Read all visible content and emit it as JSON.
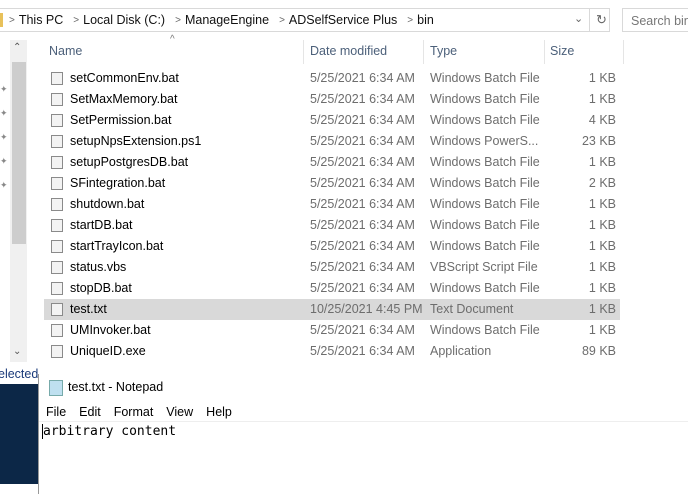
{
  "explorer": {
    "breadcrumb": [
      "This PC",
      "Local Disk (C:)",
      "ManageEngine",
      "ADSelfService Plus",
      "bin"
    ],
    "search_placeholder": "Search bin",
    "columns": {
      "name": "Name",
      "date": "Date modified",
      "type": "Type",
      "size": "Size"
    },
    "files": [
      {
        "name": "setCommonEnv.bat",
        "date": "5/25/2021 6:34 AM",
        "type": "Windows Batch File",
        "size": "1 KB",
        "icon": "batch-file-icon"
      },
      {
        "name": "SetMaxMemory.bat",
        "date": "5/25/2021 6:34 AM",
        "type": "Windows Batch File",
        "size": "1 KB",
        "icon": "batch-file-icon"
      },
      {
        "name": "SetPermission.bat",
        "date": "5/25/2021 6:34 AM",
        "type": "Windows Batch File",
        "size": "4 KB",
        "icon": "batch-file-icon"
      },
      {
        "name": "setupNpsExtension.ps1",
        "date": "5/25/2021 6:34 AM",
        "type": "Windows PowerS...",
        "size": "23 KB",
        "icon": "powershell-file-icon"
      },
      {
        "name": "setupPostgresDB.bat",
        "date": "5/25/2021 6:34 AM",
        "type": "Windows Batch File",
        "size": "1 KB",
        "icon": "batch-file-icon"
      },
      {
        "name": "SFintegration.bat",
        "date": "5/25/2021 6:34 AM",
        "type": "Windows Batch File",
        "size": "2 KB",
        "icon": "batch-file-icon"
      },
      {
        "name": "shutdown.bat",
        "date": "5/25/2021 6:34 AM",
        "type": "Windows Batch File",
        "size": "1 KB",
        "icon": "batch-file-icon"
      },
      {
        "name": "startDB.bat",
        "date": "5/25/2021 6:34 AM",
        "type": "Windows Batch File",
        "size": "1 KB",
        "icon": "batch-file-icon"
      },
      {
        "name": "startTrayIcon.bat",
        "date": "5/25/2021 6:34 AM",
        "type": "Windows Batch File",
        "size": "1 KB",
        "icon": "batch-file-icon"
      },
      {
        "name": "status.vbs",
        "date": "5/25/2021 6:34 AM",
        "type": "VBScript Script File",
        "size": "1 KB",
        "icon": "vbscript-file-icon"
      },
      {
        "name": "stopDB.bat",
        "date": "5/25/2021 6:34 AM",
        "type": "Windows Batch File",
        "size": "1 KB",
        "icon": "batch-file-icon"
      },
      {
        "name": "test.txt",
        "date": "10/25/2021 4:45 PM",
        "type": "Text Document",
        "size": "1 KB",
        "icon": "text-file-icon",
        "selected": true
      },
      {
        "name": "UMInvoker.bat",
        "date": "5/25/2021 6:34 AM",
        "type": "Windows Batch File",
        "size": "1 KB",
        "icon": "batch-file-icon"
      },
      {
        "name": "UniqueID.exe",
        "date": "5/25/2021 6:34 AM",
        "type": "Application",
        "size": "89 KB",
        "icon": "application-icon"
      }
    ],
    "status": "elected"
  },
  "notepad": {
    "title": "test.txt - Notepad",
    "menu": [
      "File",
      "Edit",
      "Format",
      "View",
      "Help"
    ],
    "content": "arbitrary content"
  },
  "colors": {
    "selected_row": "#d9d9d9",
    "header_text": "#4c607a",
    "desktop": "#0c2747"
  }
}
